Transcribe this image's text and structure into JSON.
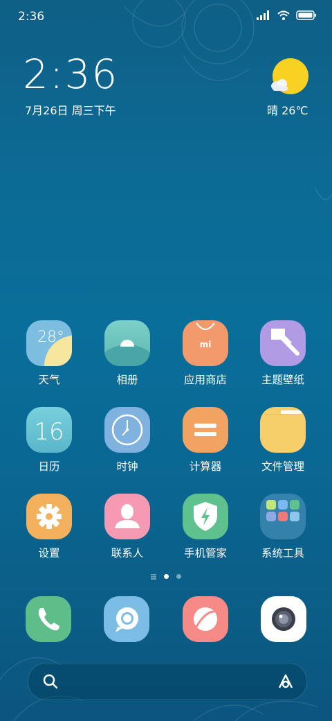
{
  "status_bar": {
    "time": "2:36"
  },
  "clock_widget": {
    "time": "2:36",
    "date": "7月26日 周三下午"
  },
  "weather_widget": {
    "text": "晴 26℃",
    "icon": "sun-cloud-icon"
  },
  "apps": [
    {
      "label": "天气",
      "icon": "weather-app-icon",
      "color": "#7dbde0",
      "badge_text": "28°"
    },
    {
      "label": "相册",
      "icon": "gallery-app-icon",
      "color": "#6cc5bd"
    },
    {
      "label": "应用商店",
      "icon": "app-store-icon",
      "color": "#f29a6c"
    },
    {
      "label": "主题壁纸",
      "icon": "themes-app-icon",
      "color": "#b09be4"
    },
    {
      "label": "日历",
      "icon": "calendar-app-icon",
      "color": "#6cc3d2",
      "badge_text": "16"
    },
    {
      "label": "时钟",
      "icon": "clock-app-icon",
      "color": "#7fb2df"
    },
    {
      "label": "计算器",
      "icon": "calculator-app-icon",
      "color": "#f2a261"
    },
    {
      "label": "文件管理",
      "icon": "files-app-icon",
      "color": "#f7cf6a"
    },
    {
      "label": "设置",
      "icon": "settings-app-icon",
      "color": "#f3b15e"
    },
    {
      "label": "联系人",
      "icon": "contacts-app-icon",
      "color": "#f59ab2"
    },
    {
      "label": "手机管家",
      "icon": "security-app-icon",
      "color": "#5fc18d"
    },
    {
      "label": "系统工具",
      "icon": "folder-icon",
      "color": "#3f88ad"
    }
  ],
  "dock": [
    {
      "icon": "phone-app-icon",
      "color": "#5fbd8a"
    },
    {
      "icon": "messages-app-icon",
      "color": "#7cbde6"
    },
    {
      "icon": "browser-app-icon",
      "color": "#f58a86"
    },
    {
      "icon": "camera-app-icon",
      "color": "#ffffff"
    }
  ],
  "search_bar": {
    "search_icon": "search-icon",
    "assistant_icon": "assistant-icon"
  }
}
